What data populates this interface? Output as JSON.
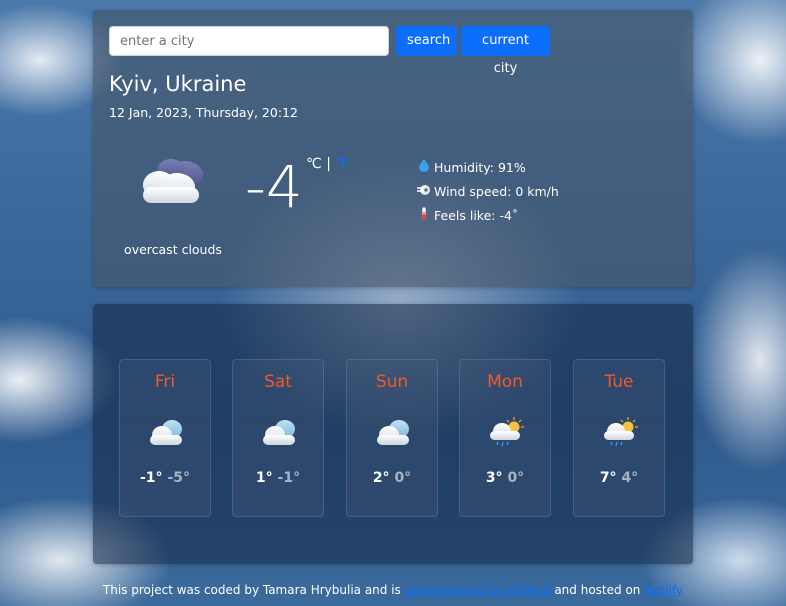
{
  "search": {
    "placeholder": "enter a city",
    "value": ""
  },
  "buttons": {
    "search_label": "search",
    "current_city_label": "current city"
  },
  "current": {
    "city": "Kyiv, Ukraine",
    "date": "12 Jan, 2023, Thursday, 20:12",
    "temperature": "-4",
    "unit_celsius": "℃",
    "unit_separator": "|",
    "unit_fahrenheit": "℉",
    "description": "overcast clouds",
    "icon": "overcast-clouds-icon",
    "humidity": "Humidity: 91%",
    "wind": "Wind speed: 0 km/h",
    "feels_like": "Feels like: -4˚"
  },
  "forecast": [
    {
      "day": "Fri",
      "max": "-1°",
      "min": "-5°",
      "icon": "cloudy-icon"
    },
    {
      "day": "Sat",
      "max": "1°",
      "min": "-1°",
      "icon": "cloudy-icon"
    },
    {
      "day": "Sun",
      "max": "2°",
      "min": "0°",
      "icon": "cloudy-icon"
    },
    {
      "day": "Mon",
      "max": "3°",
      "min": "0°",
      "icon": "sun-cloud-rain-icon"
    },
    {
      "day": "Tue",
      "max": "7°",
      "min": "4°",
      "icon": "sun-cloud-rain-icon"
    }
  ],
  "footer": {
    "prefix": "This project was coded by Tamara Hrybulia and is ",
    "github_link": "open-sourced on GitHub",
    "middle": " and hosted on ",
    "netlify_link": "Netlify"
  },
  "colors": {
    "accent": "#0d6efd",
    "day_label": "#f05a28",
    "min_temp": "#a8b4c4"
  }
}
